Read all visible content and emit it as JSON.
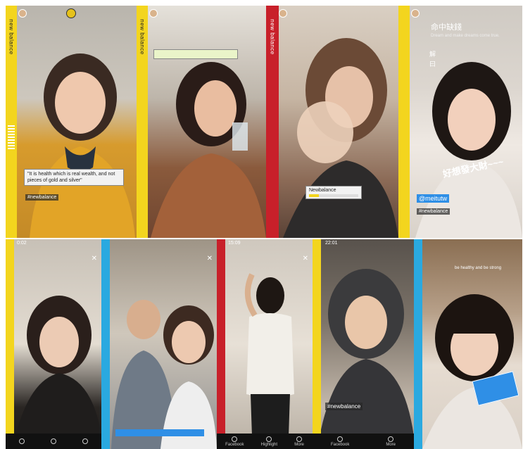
{
  "colors": {
    "yellow": "#f3d51e",
    "red": "#c8202a",
    "blue": "#2aa9e0",
    "badge": "#e6c21b",
    "sticker_blue": "#2f8fe6"
  },
  "brand": "new balance",
  "stories": [
    {
      "username": "",
      "time": "",
      "quote_line1": "\"It is health which is real wealth, and not",
      "quote_line2": "pieces of gold and silver\"",
      "tag": "#newbalance"
    },
    {
      "username": "",
      "time": ""
    },
    {
      "username": "",
      "time": "",
      "sticker_title": "Newbalance",
      "sticker_sub": ""
    },
    {
      "username": "",
      "time": "",
      "title_zh": "命中缺錢",
      "subtitle_en": "Dream and make dreams come true.",
      "explain_zh": "解",
      "explain2_zh": "曰",
      "text_zh": "好想發大財~~~",
      "mention": "@meitutw",
      "tag": "#newbalance"
    },
    {
      "username": "",
      "time": "",
      "status_time": "0:02"
    },
    {
      "username": "",
      "time": ""
    },
    {
      "username": "",
      "time": "",
      "status_time": "15:09",
      "bottom": [
        "Facebook",
        "Highlight",
        "More"
      ]
    },
    {
      "username": "",
      "time": "",
      "status_time": "22:01",
      "hashtag": "#newbalance",
      "bottom": [
        "Facebook",
        "More"
      ]
    },
    {
      "username": "",
      "time": "",
      "top_text_en": "be healthy and be strong"
    }
  ]
}
